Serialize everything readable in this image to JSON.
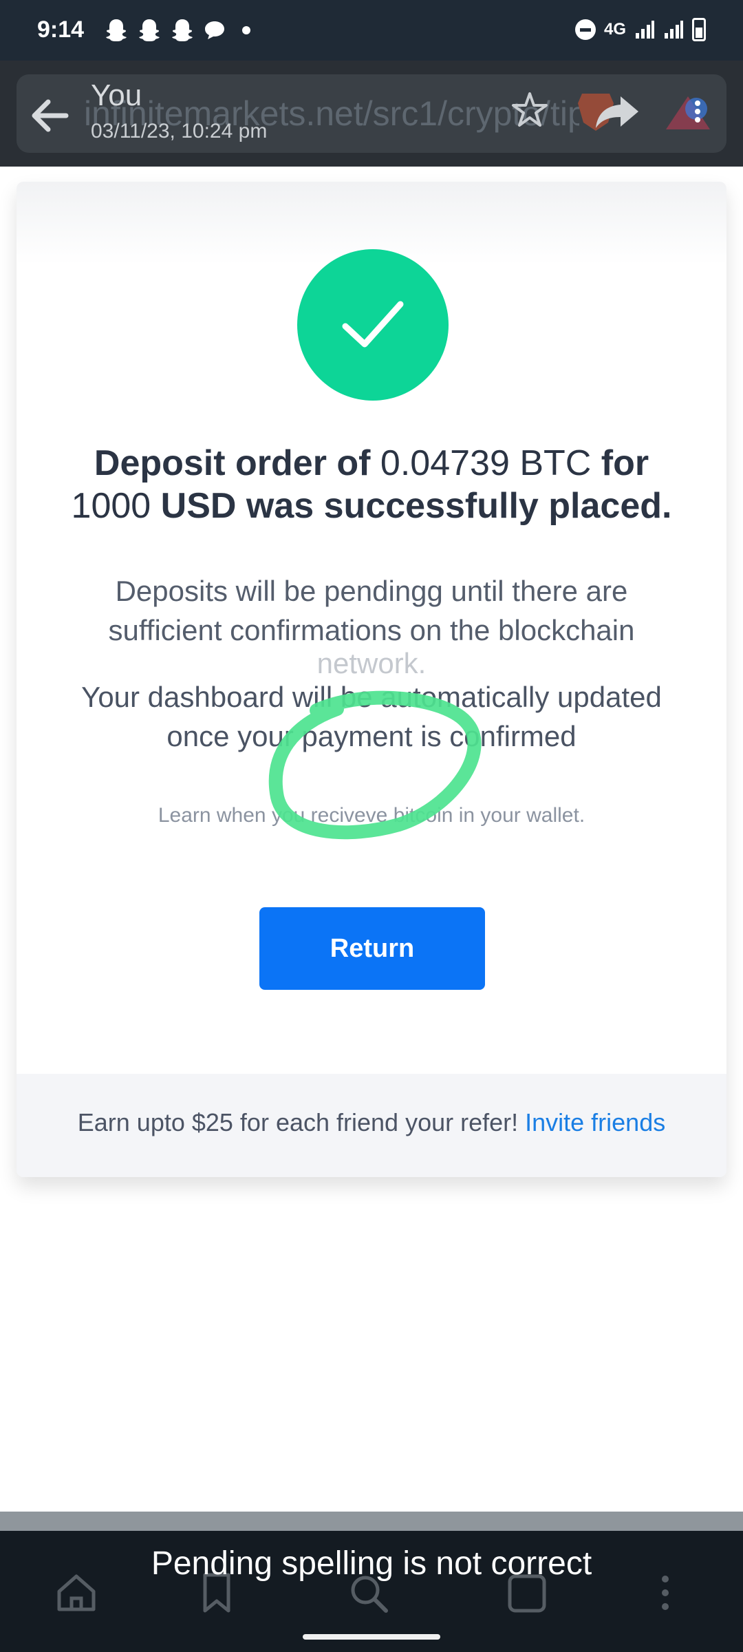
{
  "status_bar": {
    "time": "9:14",
    "network": "4G",
    "notification_icons": [
      "snapchat-icon",
      "snapchat-icon",
      "snapchat-icon",
      "chat-bubble-icon",
      "dot-icon"
    ],
    "system_icons": [
      "do-not-disturb-icon",
      "signal-icon",
      "signal-icon",
      "battery-icon"
    ]
  },
  "chat_header": {
    "sender": "You",
    "timestamp": "03/11/23, 10:24 pm",
    "url": "infinitemarkets.net/src1/crypto/tip"
  },
  "card": {
    "headline_part1": "Deposit order of ",
    "headline_amount_btc": "0.04739 BTC",
    "headline_part2": " for",
    "headline_amount_usd": "1000",
    "headline_part3": " USD was successfully placed.",
    "pending_line1": "Deposits will be pendingg until there are",
    "pending_line2": "sufficient confirmations on the blockchain",
    "pending_line3": "network.",
    "dashboard_line1": "Your dashboard will be automatically updated",
    "dashboard_line2": "once your payment is confirmed",
    "learn_text": "Learn when you reciveve bitcoin in your wallet.",
    "return_label": "Return",
    "earn_text": "Earn upto $25 for each friend your refer! ",
    "invite_label": "Invite friends"
  },
  "caption": "Pending spelling is not correct",
  "colors": {
    "success_green": "#0dd597",
    "button_blue": "#0b74f6",
    "link_blue": "#1a7ee4",
    "annotation_green": "#4de38f"
  }
}
